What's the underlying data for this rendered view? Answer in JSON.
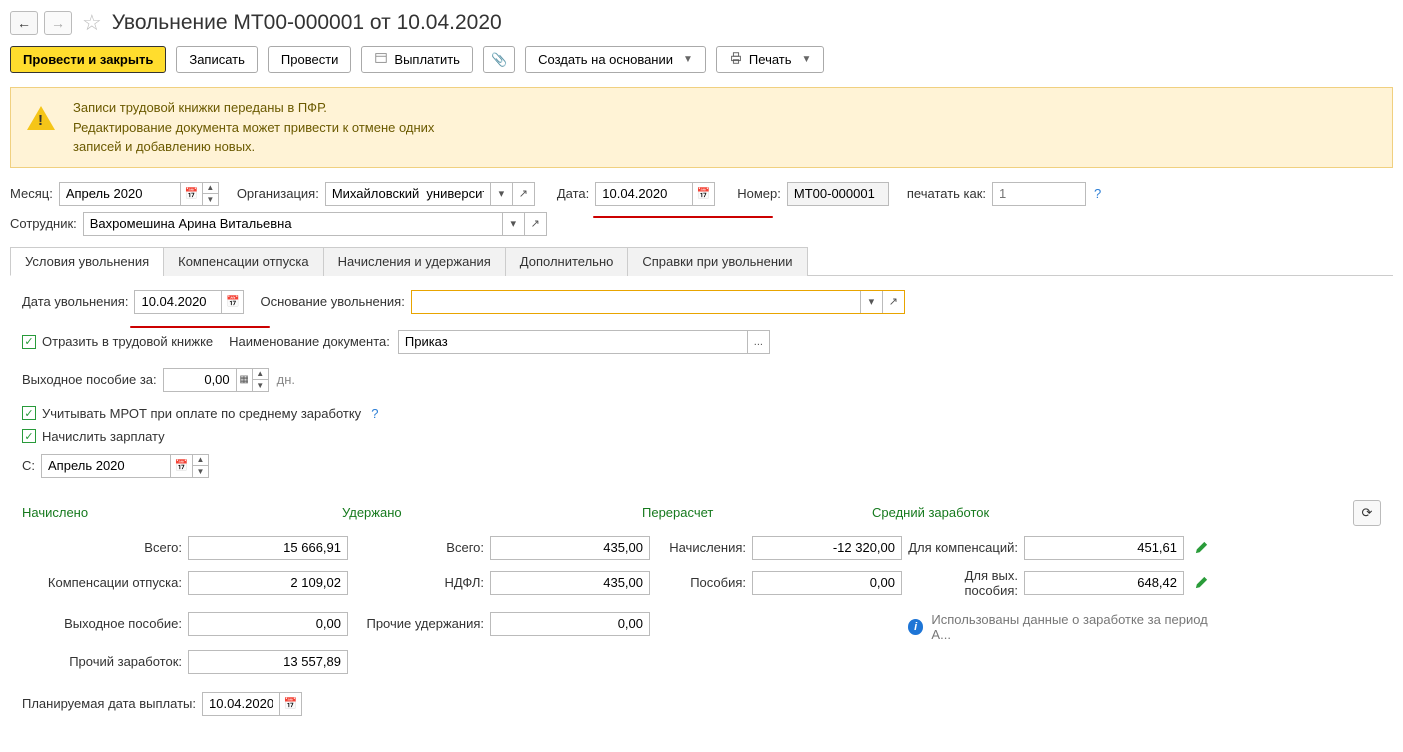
{
  "header": {
    "title": "Увольнение МТ00-000001 от 10.04.2020"
  },
  "toolbar": {
    "execute_close": "Провести и закрыть",
    "save": "Записать",
    "execute": "Провести",
    "pay": "Выплатить",
    "create_based": "Создать на основании",
    "print": "Печать"
  },
  "warning": {
    "line1": "Записи трудовой книжки переданы в ПФР.",
    "line2": "Редактирование документа может привести к отмене одних",
    "line3": "записей и добавлению новых."
  },
  "form": {
    "month_label": "Месяц:",
    "month_value": "Апрель 2020",
    "org_label": "Организация:",
    "org_value": "Михайловский  университет",
    "date_label": "Дата:",
    "date_value": "10.04.2020",
    "number_label": "Номер:",
    "number_value": "МТ00-000001",
    "print_as_label": "печатать как:",
    "print_as_placeholder": "1",
    "employee_label": "Сотрудник:",
    "employee_value": "Вахромешина Арина Витальевна"
  },
  "tabs": {
    "t1": "Условия увольнения",
    "t2": "Компенсации отпуска",
    "t3": "Начисления и удержания",
    "t4": "Дополнительно",
    "t5": "Справки при увольнении"
  },
  "cond": {
    "termination_date_label": "Дата увольнения:",
    "termination_date_value": "10.04.2020",
    "reason_label": "Основание увольнения:",
    "reason_value": "",
    "reflect_label": "Отразить в трудовой книжке",
    "doc_name_label": "Наименование документа:",
    "doc_name_value": "Приказ",
    "severance_label": "Выходное пособие за:",
    "severance_value": "0,00",
    "severance_unit": "дн.",
    "mrot_label": "Учитывать МРОТ при оплате по среднему заработку",
    "accrue_label": "Начислить зарплату",
    "from_label": "С:",
    "from_value": "Апрель 2020"
  },
  "sections": {
    "accrued": "Начислено",
    "withheld": "Удержано",
    "recalc": "Перерасчет",
    "avg": "Средний заработок"
  },
  "calc": {
    "total_label": "Всего:",
    "accrued_total": "15 666,91",
    "vac_comp_label": "Компенсации отпуска:",
    "vac_comp": "2 109,02",
    "severance_out_label": "Выходное пособие:",
    "severance_out": "0,00",
    "other_earn_label": "Прочий заработок:",
    "other_earn": "13 557,89",
    "withheld_total_label": "Всего:",
    "withheld_total": "435,00",
    "ndfl_label": "НДФЛ:",
    "ndfl": "435,00",
    "other_with_label": "Прочие удержания:",
    "other_with": "0,00",
    "recalc_acc_label": "Начисления:",
    "recalc_acc": "-12 320,00",
    "recalc_ben_label": "Пособия:",
    "recalc_ben": "0,00",
    "avg_comp_label": "Для компенсаций:",
    "avg_comp": "451,61",
    "avg_sev_label": "Для вых. пособия:",
    "avg_sev": "648,42",
    "avg_info": "Использованы данные о заработке за период А..."
  },
  "payout": {
    "date_label": "Планируемая дата выплаты:",
    "date_value": "10.04.2020"
  }
}
